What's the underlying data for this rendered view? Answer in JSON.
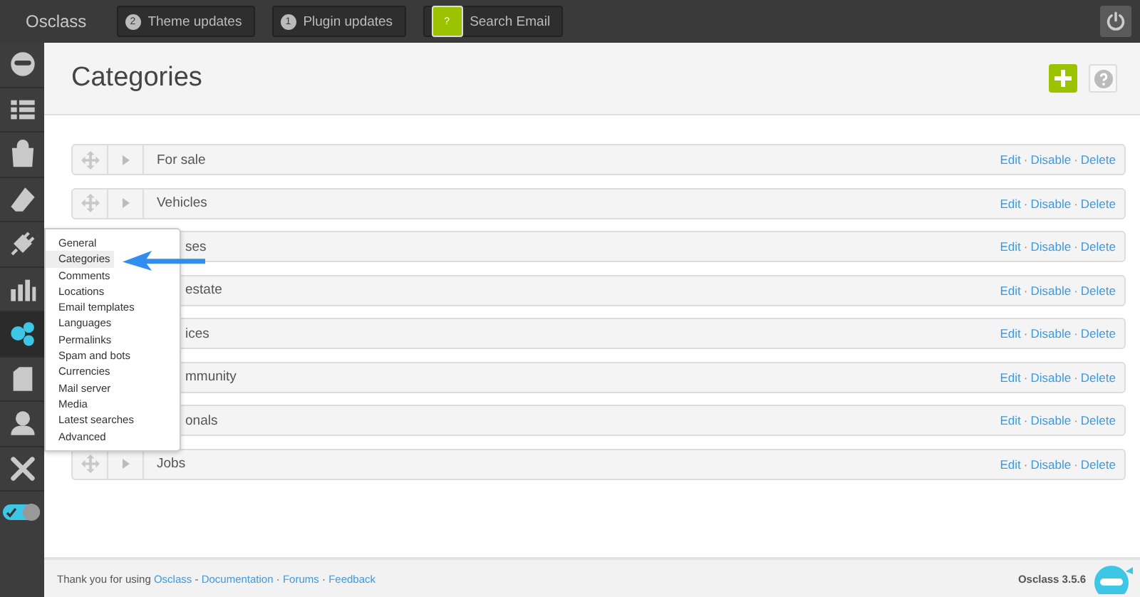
{
  "topbar": {
    "brand": "Osclass",
    "buttons": [
      {
        "badge": "2",
        "label": "Theme updates",
        "kind": "count"
      },
      {
        "badge": "1",
        "label": "Plugin updates",
        "kind": "count"
      },
      {
        "badge": "?",
        "label": "Search Email",
        "kind": "help"
      }
    ]
  },
  "sidebar": {
    "items": [
      {
        "kind": "dashboard",
        "selected": false
      },
      {
        "kind": "listings",
        "selected": false
      },
      {
        "kind": "bag",
        "selected": false
      },
      {
        "kind": "eraser",
        "selected": false
      },
      {
        "kind": "plugin",
        "selected": false
      },
      {
        "kind": "stats",
        "selected": false
      },
      {
        "kind": "settings",
        "selected": true
      },
      {
        "kind": "page",
        "selected": false
      },
      {
        "kind": "user",
        "selected": false
      },
      {
        "kind": "tools",
        "selected": false
      }
    ],
    "toggle": {
      "on": true
    }
  },
  "page": {
    "title": "Categories"
  },
  "separator": "·",
  "categories": [
    {
      "name": "For sale",
      "covered": false,
      "actions": [
        "Edit",
        "Disable",
        "Delete"
      ]
    },
    {
      "name": "Vehicles",
      "covered": false,
      "actions": [
        "Edit",
        "Disable",
        "Delete"
      ]
    },
    {
      "name": "ses",
      "covered": true,
      "actions": [
        "Edit",
        "Disable",
        "Delete"
      ]
    },
    {
      "name": "estate",
      "covered": true,
      "actions": [
        "Edit",
        "Disable",
        "Delete"
      ]
    },
    {
      "name": "ices",
      "covered": true,
      "actions": [
        "Edit",
        "Disable",
        "Delete"
      ]
    },
    {
      "name": "mmunity",
      "covered": true,
      "actions": [
        "Edit",
        "Disable",
        "Delete"
      ]
    },
    {
      "name": "onals",
      "covered": true,
      "actions": [
        "Edit",
        "Disable",
        "Delete"
      ]
    },
    {
      "name": "Jobs",
      "covered": false,
      "actions": [
        "Edit",
        "Disable",
        "Delete"
      ]
    }
  ],
  "menu": {
    "items": [
      {
        "label": "General",
        "selected": false
      },
      {
        "label": "Categories",
        "selected": true
      },
      {
        "label": "Comments",
        "selected": false
      },
      {
        "label": "Locations",
        "selected": false
      },
      {
        "label": "Email templates",
        "selected": false
      },
      {
        "label": "Languages",
        "selected": false
      },
      {
        "label": "Permalinks",
        "selected": false
      },
      {
        "label": "Spam and bots",
        "selected": false
      },
      {
        "label": "Currencies",
        "selected": false
      },
      {
        "label": "Mail server",
        "selected": false
      },
      {
        "label": "Media",
        "selected": false
      },
      {
        "label": "Latest searches",
        "selected": false
      },
      {
        "label": "Advanced",
        "selected": false
      }
    ]
  },
  "footer": {
    "parts": [
      {
        "kind": "text",
        "text": "Thank you for using"
      },
      {
        "kind": "link",
        "text": "Osclass"
      },
      {
        "kind": "sep",
        "text": "-"
      },
      {
        "kind": "link",
        "text": "Documentation"
      },
      {
        "kind": "sep",
        "text": "·"
      },
      {
        "kind": "link",
        "text": "Forums"
      },
      {
        "kind": "sep",
        "text": "·"
      },
      {
        "kind": "link",
        "text": "Feedback"
      }
    ],
    "version": "Osclass 3.5.6"
  }
}
